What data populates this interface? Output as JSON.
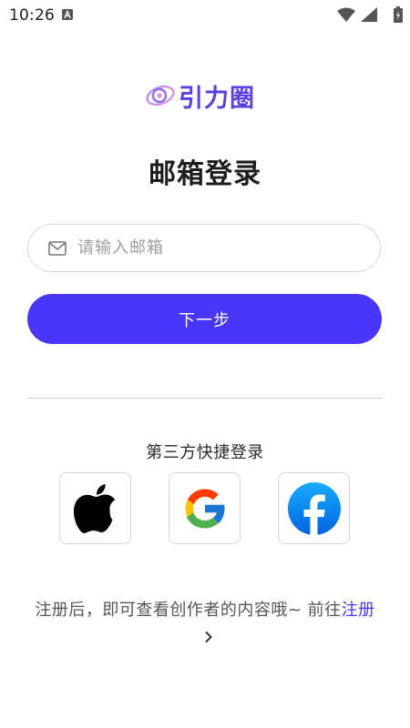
{
  "status_bar": {
    "time": "10:26"
  },
  "logo": {
    "text": "引力圈",
    "brand_color": "#5b3fe0"
  },
  "page": {
    "title": "邮箱登录"
  },
  "email": {
    "placeholder": "请输入邮箱",
    "value": ""
  },
  "next_button": {
    "label": "下一步",
    "color": "#4a36fb"
  },
  "third_party": {
    "title": "第三方快捷登录",
    "providers": [
      "apple-icon",
      "google-icon",
      "facebook-icon"
    ]
  },
  "footer": {
    "text": "注册后，即可查看创作者的内容哦~ 前往",
    "link_label": "注册"
  }
}
